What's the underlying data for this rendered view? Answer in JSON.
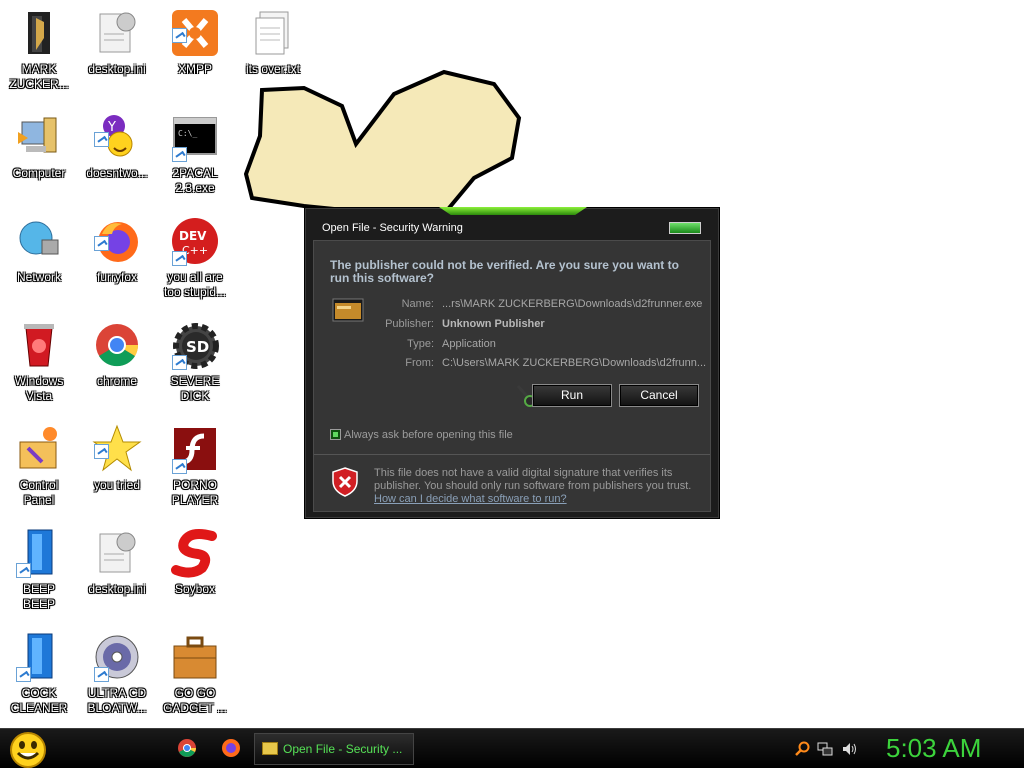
{
  "desktop": {
    "icons": [
      {
        "label": "MARK\nZUCKER..."
      },
      {
        "label": "desktop.ini"
      },
      {
        "label": "XMPP"
      },
      {
        "label": "its over.txt"
      },
      {
        "label": "Computer"
      },
      {
        "label": "doesntwo..."
      },
      {
        "label": "2PACAL\n2.3.exe"
      },
      {
        "label": "Network"
      },
      {
        "label": "furryfox"
      },
      {
        "label": "you all are\ntoo stupid..."
      },
      {
        "label": "Windows\nVista"
      },
      {
        "label": "chrome"
      },
      {
        "label": "SEVERE\nDICK"
      },
      {
        "label": "Control\nPanel"
      },
      {
        "label": "you tried"
      },
      {
        "label": "PORNO\nPLAYER"
      },
      {
        "label": "BEEP\nBEEP"
      },
      {
        "label": "desktop.ini"
      },
      {
        "label": "Soybox"
      },
      {
        "label": "COCK\nCLEANER"
      },
      {
        "label": "ULTRA CD\nBLOATW..."
      },
      {
        "label": "GO GO\nGADGET ..."
      }
    ]
  },
  "dialog": {
    "title": "Open File - Security Warning",
    "question": "The publisher could not be verified.  Are you sure you want to run this software?",
    "fields": {
      "name_label": "Name:",
      "name_value": "...rs\\MARK ZUCKERBERG\\Downloads\\d2frunner.exe",
      "publisher_label": "Publisher:",
      "publisher_value": "Unknown Publisher",
      "type_label": "Type:",
      "type_value": "Application",
      "from_label": "From:",
      "from_value": "C:\\Users\\MARK ZUCKERBERG\\Downloads\\d2frunn..."
    },
    "run_label": "Run",
    "cancel_label": "Cancel",
    "checkbox_label": "Always ask before opening this file",
    "checkbox_checked": true,
    "warning_text": "This file does not have a valid digital signature that verifies its publisher.  You should only run software from publishers you trust.",
    "warning_link": "How can I decide what software to run?"
  },
  "taskbar": {
    "active_window": "Open File - Security ...",
    "clock": "5:03 AM",
    "accent_color": "#3cd33c"
  }
}
